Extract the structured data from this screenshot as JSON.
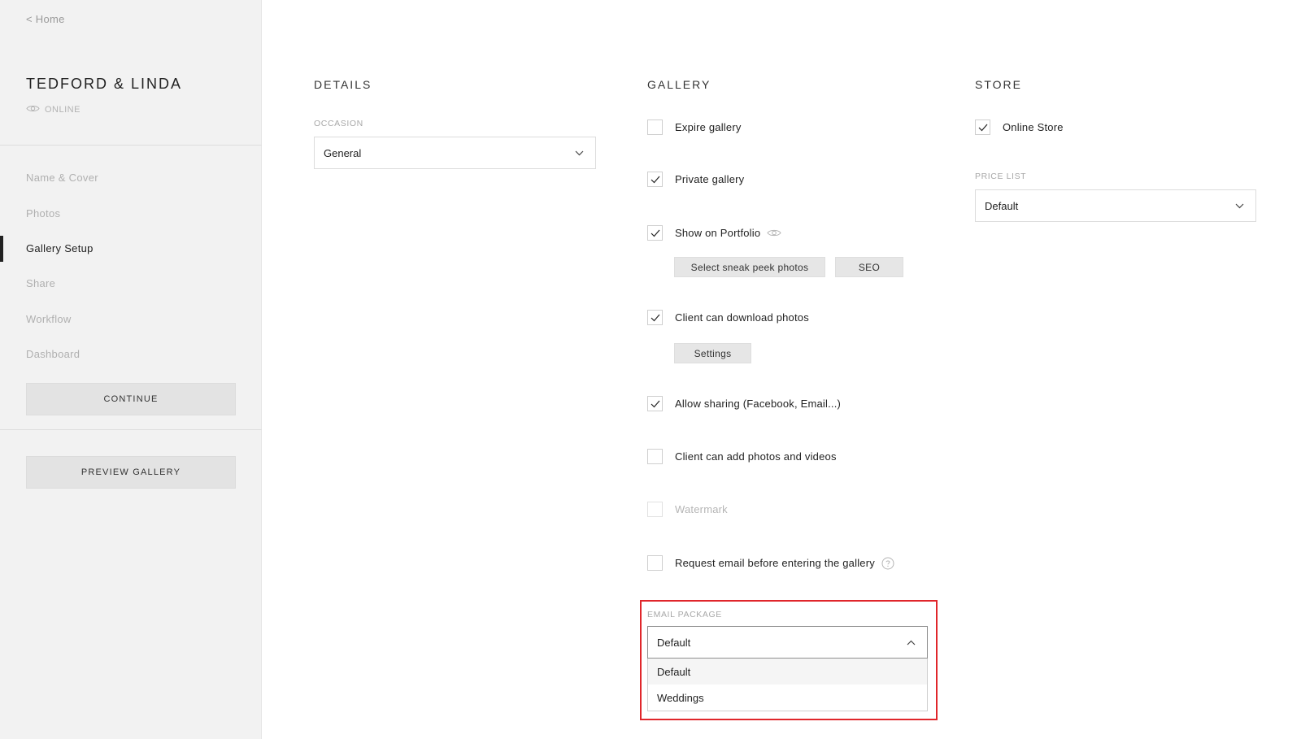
{
  "sidebar": {
    "home_link": "< Home",
    "gallery_title": "TEDFORD & LINDA",
    "status": "ONLINE",
    "nav": [
      "Name & Cover",
      "Photos",
      "Gallery Setup",
      "Share",
      "Workflow",
      "Dashboard"
    ],
    "active_nav": "Gallery Setup",
    "continue_label": "CONTINUE",
    "preview_label": "PREVIEW GALLERY"
  },
  "details": {
    "title": "DETAILS",
    "occasion_label": "OCCASION",
    "occasion_value": "General"
  },
  "gallery": {
    "title": "GALLERY",
    "options": {
      "expire": {
        "label": "Expire gallery",
        "checked": false
      },
      "private": {
        "label": "Private gallery",
        "checked": true
      },
      "portfolio": {
        "label": "Show on Portfolio",
        "checked": true
      },
      "download": {
        "label": "Client can download photos",
        "checked": true
      },
      "sharing": {
        "label": "Allow sharing (Facebook, Email...)",
        "checked": true
      },
      "add_photos": {
        "label": "Client can add photos and videos",
        "checked": false
      },
      "watermark": {
        "label": "Watermark",
        "checked": false,
        "disabled": true
      },
      "request_email": {
        "label": "Request email before entering the gallery",
        "checked": false
      }
    },
    "sneak_peek_button": "Select sneak peek photos",
    "seo_button": "SEO",
    "settings_button": "Settings",
    "email_package_label": "EMAIL PACKAGE",
    "email_package_value": "Default",
    "email_package_options": [
      "Default",
      "Weddings"
    ]
  },
  "store": {
    "title": "STORE",
    "online_store": {
      "label": "Online Store",
      "checked": true
    },
    "price_list_label": "PRICE LIST",
    "price_list_value": "Default"
  },
  "colors": {
    "highlight": "#e0262b",
    "sidebar_bg": "#f2f2f2",
    "active_indicator": "#222222"
  }
}
